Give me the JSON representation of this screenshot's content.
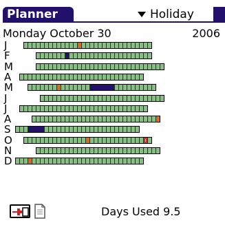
{
  "app": {
    "title": "Planner",
    "accent": "#22106b"
  },
  "category": {
    "selected": "Holiday"
  },
  "header": {
    "date": "Monday October 30",
    "year": "2006"
  },
  "months": [
    {
      "letter": "J",
      "offset": 2,
      "days": 31,
      "marks": [
        {
          "day": 14,
          "len": 1,
          "type": "holiday"
        }
      ]
    },
    {
      "letter": "F",
      "offset": 5,
      "days": 28,
      "marks": [
        {
          "day": 8,
          "len": 1,
          "type": "used"
        }
      ]
    },
    {
      "letter": "M",
      "offset": 5,
      "days": 31,
      "marks": []
    },
    {
      "letter": "A",
      "offset": 1,
      "days": 30,
      "marks": []
    },
    {
      "letter": "M",
      "offset": 3,
      "days": 31,
      "marks": [
        {
          "day": 8,
          "len": 1,
          "type": "holiday"
        },
        {
          "day": 16,
          "len": 6,
          "type": "used"
        }
      ]
    },
    {
      "letter": "J",
      "offset": 6,
      "days": 30,
      "marks": []
    },
    {
      "letter": "J",
      "offset": 1,
      "days": 31,
      "marks": []
    },
    {
      "letter": "A",
      "offset": 4,
      "days": 31,
      "marks": [
        {
          "day": 31,
          "len": 1,
          "type": "holiday"
        }
      ]
    },
    {
      "letter": "S",
      "offset": 0,
      "days": 30,
      "marks": [
        {
          "day": 4,
          "len": 4,
          "type": "used"
        }
      ]
    },
    {
      "letter": "O",
      "offset": 2,
      "days": 31,
      "marks": [
        {
          "day": 16,
          "len": 1,
          "type": "holiday"
        },
        {
          "day": 30,
          "len": 1,
          "type": "today"
        }
      ]
    },
    {
      "letter": "N",
      "offset": 5,
      "days": 30,
      "marks": []
    },
    {
      "letter": "D",
      "offset": 0,
      "days": 31,
      "marks": [
        {
          "day": 4,
          "len": 1,
          "type": "holiday"
        }
      ]
    }
  ],
  "footer": {
    "days_used": "Days Used 9.5"
  },
  "colors": {
    "day": "#86c082",
    "holiday": "#e06a1c",
    "used": "#22106b",
    "today_ring": "#e02828"
  }
}
